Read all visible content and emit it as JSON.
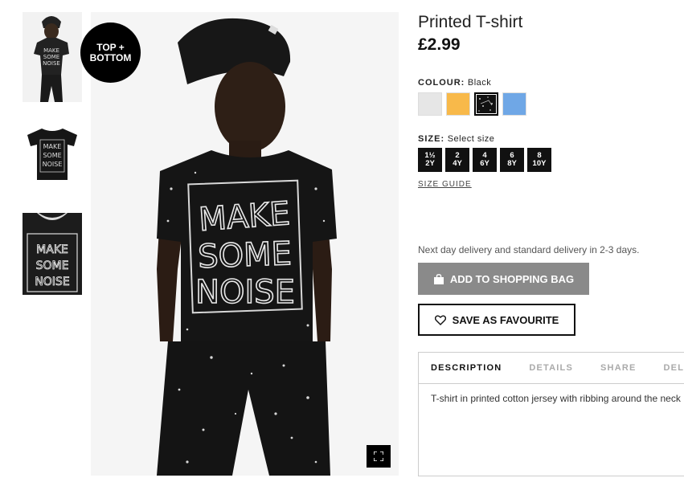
{
  "product": {
    "title": "Printed T-shirt",
    "price": "£2.99",
    "promo_badge": [
      "TOP +",
      "BOTTOM"
    ]
  },
  "colour": {
    "label": "COLOUR:",
    "selected": "Black",
    "swatches": [
      {
        "name": "light grey",
        "color": "#e6e6e6"
      },
      {
        "name": "yellow",
        "color": "#f8b94a"
      },
      {
        "name": "black",
        "color": "#111111"
      },
      {
        "name": "blue",
        "color": "#6fa7e6"
      }
    ]
  },
  "size": {
    "label": "SIZE:",
    "placeholder": "Select size",
    "options": [
      {
        "top": "1½",
        "bottom": "2Y"
      },
      {
        "top": "2",
        "bottom": "4Y"
      },
      {
        "top": "4",
        "bottom": "6Y"
      },
      {
        "top": "6",
        "bottom": "8Y"
      },
      {
        "top": "8",
        "bottom": "10Y"
      }
    ],
    "guide_label": "SIZE GUIDE"
  },
  "delivery_text": "Next day delivery and standard delivery in 2-3 days.",
  "actions": {
    "add_to_bag": "ADD TO SHOPPING BAG",
    "save_favourite": "SAVE AS FAVOURITE"
  },
  "tabs": [
    "DESCRIPTION",
    "DETAILS",
    "SHARE",
    "DELIVI"
  ],
  "description_text": "T-shirt in printed cotton jersey with ribbing around the neck",
  "shirt_print": [
    "MAKE",
    "SOME",
    "NOISE"
  ]
}
